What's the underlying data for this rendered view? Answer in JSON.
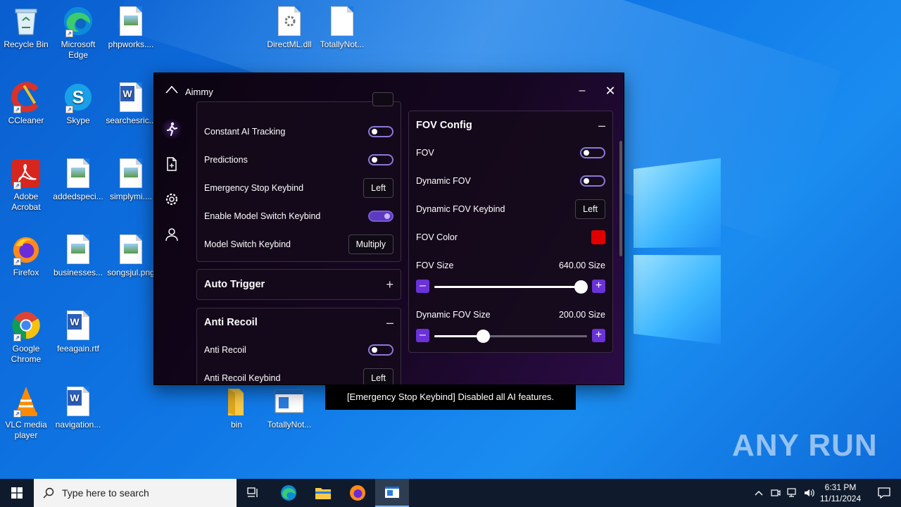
{
  "desktop": {
    "icons": [
      {
        "label": "Recycle Bin"
      },
      {
        "label": "Microsoft Edge"
      },
      {
        "label": "phpworks...."
      },
      {
        "label": "DirectML.dll"
      },
      {
        "label": "TotallyNot..."
      },
      {
        "label": "CCleaner"
      },
      {
        "label": "Skype"
      },
      {
        "label": "searchesric..."
      },
      {
        "label": "Adobe Acrobat"
      },
      {
        "label": "addedspeci..."
      },
      {
        "label": "simplymi...."
      },
      {
        "label": "Firefox"
      },
      {
        "label": "businesses..."
      },
      {
        "label": "songsjul.png"
      },
      {
        "label": "Google Chrome"
      },
      {
        "label": "feeagain.rtf"
      },
      {
        "label": "VLC media player"
      },
      {
        "label": "navigation..."
      },
      {
        "label": "bin"
      },
      {
        "label": "TotallyNot..."
      }
    ]
  },
  "window": {
    "title": "Aimmy",
    "minimize_symbol": "–",
    "close_symbol": "✕"
  },
  "left_panel": {
    "rows": [
      {
        "label": "Constant AI Tracking",
        "control": "toggle",
        "on": false
      },
      {
        "label": "Predictions",
        "control": "toggle",
        "on": false
      },
      {
        "label": "Emergency Stop Keybind",
        "control": "key",
        "key": "Left"
      },
      {
        "label": "Enable Model Switch Keybind",
        "control": "toggle",
        "on": true
      },
      {
        "label": "Model Switch Keybind",
        "control": "key",
        "key": "Multiply"
      }
    ]
  },
  "auto_trigger": {
    "title": "Auto Trigger",
    "symbol": "+"
  },
  "anti_recoil": {
    "title": "Anti Recoil",
    "symbol": "–",
    "rows": [
      {
        "label": "Anti Recoil",
        "control": "toggle",
        "on": false
      },
      {
        "label": "Anti Recoil Keybind",
        "control": "key",
        "key": "Left"
      }
    ]
  },
  "fov_config": {
    "title": "FOV Config",
    "symbol": "–",
    "fov_label": "FOV",
    "fov_on": false,
    "dynamic_fov_label": "Dynamic FOV",
    "dynamic_fov_on": false,
    "dynamic_fov_keybind_label": "Dynamic FOV Keybind",
    "dynamic_fov_keybind_key": "Left",
    "fov_color_label": "FOV Color",
    "fov_color": "#e00000",
    "fov_size_label": "FOV Size",
    "fov_size_value": "640.00 Size",
    "fov_size_fraction": 0.96,
    "dynamic_fov_size_label": "Dynamic FOV Size",
    "dynamic_fov_size_value": "200.00 Size",
    "dynamic_fov_size_fraction": 0.32,
    "minus_symbol": "–",
    "plus_symbol": "+"
  },
  "toast": {
    "text": "[Emergency Stop Keybind] Disabled all AI features."
  },
  "taskbar": {
    "search_placeholder": "Type here to search",
    "time": "6:31 PM",
    "date": "11/11/2024"
  },
  "watermark": {
    "text": "ANY RUN"
  }
}
